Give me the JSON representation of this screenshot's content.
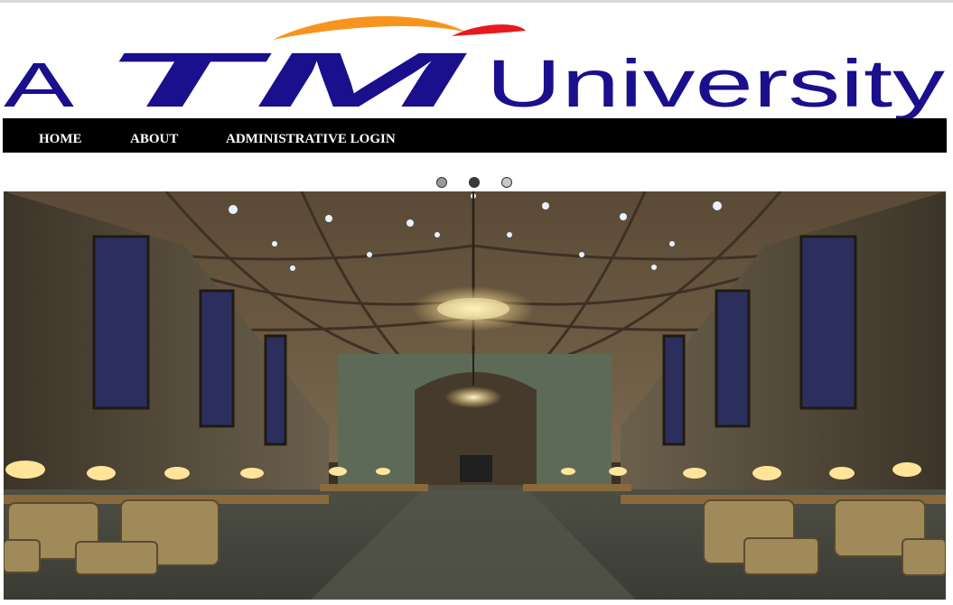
{
  "logo": {
    "prefix": "A",
    "brand": "TM",
    "suffix": "University",
    "colors": {
      "blue": "#1a0f8c",
      "orange": "#f7941d",
      "red": "#e8191e"
    }
  },
  "nav": {
    "items": [
      {
        "label": "HOME"
      },
      {
        "label": "ABOUT"
      },
      {
        "label": "ADMINISTRATIVE LOGIN"
      }
    ]
  },
  "slider": {
    "total_slides": 3,
    "active_index": 1,
    "image": "library-reading-room"
  }
}
